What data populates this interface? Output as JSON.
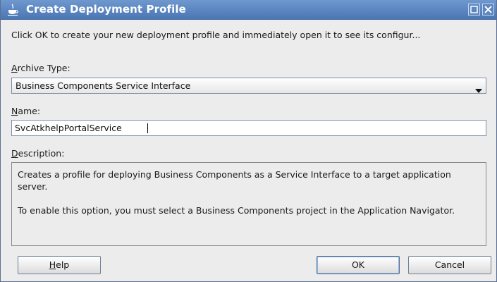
{
  "window": {
    "title": "Create Deployment Profile",
    "title_bar_color": "#4a76b4"
  },
  "intro_text": "Click OK to create your new deployment profile and immediately open it to see its configur...",
  "archive_type": {
    "label_mnemonic": "A",
    "label_rest": "rchive Type:",
    "selected_value": "Business Components Service Interface"
  },
  "name": {
    "label_mnemonic": "N",
    "label_rest": "ame:",
    "value": "SvcAtkhelpPortalService"
  },
  "description": {
    "label_mnemonic": "D",
    "label_rest": "escription:",
    "paragraph_1": "Creates a profile for deploying Business Components as a Service Interface to a target application server.",
    "paragraph_2": "To enable this option, you must select a Business Components project in the Application Navigator."
  },
  "buttons": {
    "help_mnemonic": "H",
    "help_rest": "elp",
    "ok_label": "OK",
    "cancel_label": "Cancel"
  },
  "icons": {
    "app": "java-cup-icon",
    "maximize": "maximize-icon",
    "close": "close-icon",
    "dropdown": "dropdown-arrow-icon"
  }
}
